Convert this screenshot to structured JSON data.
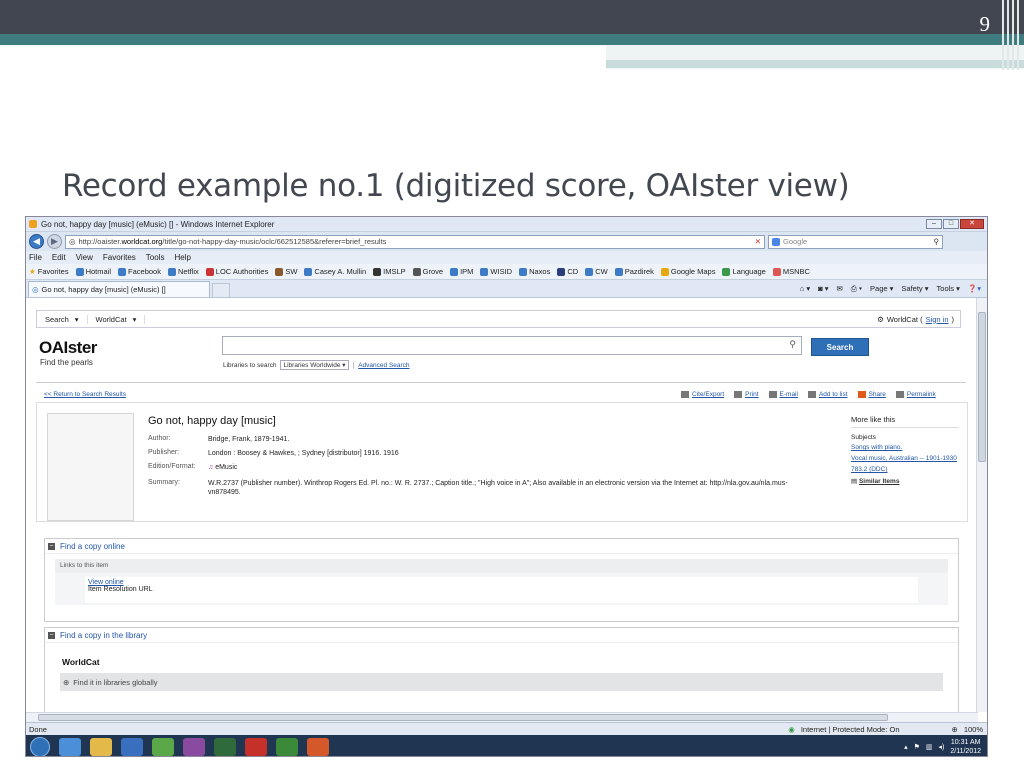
{
  "slide": {
    "number": "9",
    "title": "Record example no.1 (digitized score, OAIster view)"
  },
  "browser": {
    "window_title": "Go not, happy day [music] (eMusic) [] - Windows Internet Explorer",
    "url_prefix": "http://oaister.",
    "url_domain": "worldcat.org",
    "url_rest": "/title/go-not-happy-day-music/oclc/662512585&referer=brief_results",
    "search_placeholder": "Google",
    "menu": [
      "File",
      "Edit",
      "View",
      "Favorites",
      "Tools",
      "Help"
    ],
    "favorites_label": "Favorites",
    "favorites": [
      "Hotmail",
      "Facebook",
      "Netflix",
      "LOC Authorities",
      "SW",
      "Casey A. Mullin",
      "IMSLP",
      "Grove",
      "IPM",
      "WISID",
      "Naxos",
      "CD",
      "CW",
      "Pazdirek",
      "Google Maps",
      "Language",
      "MSNBC"
    ],
    "tab_title": "Go not, happy day [music] (eMusic) []",
    "commands": [
      "Page ▾",
      "Safety ▾",
      "Tools ▾"
    ],
    "status_left": "Done",
    "status_zone": "Internet | Protected Mode: On",
    "zoom": "100%",
    "clock_time": "10:31 AM",
    "clock_date": "2/11/2012"
  },
  "worldcat": {
    "nav_search": "Search",
    "nav_worldcat": "WorldCat",
    "signin_prefix": "WorldCat (",
    "signin_link": "Sign in",
    "signin_suffix": ")",
    "logo": "OAIster",
    "tagline": "Find the pearls",
    "search_button": "Search",
    "libraries_label": "Libraries to search",
    "libraries_value": "Libraries Worldwide",
    "advanced_search": "Advanced Search",
    "back_link": "<< Return to Search Results",
    "tools": [
      "Cite/Export",
      "Print",
      "E-mail",
      "Add to list",
      "Share",
      "Permalink"
    ],
    "record": {
      "title": "Go not, happy day [music]",
      "author_label": "Author:",
      "author": "Bridge, Frank, 1879-1941.",
      "publisher_label": "Publisher:",
      "publisher": "London : Boosey & Hawkes, ; Sydney [distributor] 1916. 1916",
      "format_label": "Edition/Format:",
      "format": "eMusic",
      "summary_label": "Summary:",
      "summary": "W.R.2737 (Publisher number). Winthrop Rogers Ed. Pl. no.: W. R. 2737.; Caption title.; \"High voice in A\"; Also available in an electronic version via the Internet at: http://nla.gov.au/nla.mus-vn878495."
    },
    "more_like_this": {
      "heading": "More like this",
      "subjects_label": "Subjects",
      "subjects": [
        "Songs with piano.",
        "Vocal music, Australian -- 1901-1930",
        "783.2 (DDC)"
      ],
      "similar_items": "Similar Items"
    },
    "find_online": {
      "heading": "Find a copy online",
      "links_heading": "Links to this item",
      "view_online": "View online",
      "resolution": "Item Resolution URL"
    },
    "find_library": {
      "heading": "Find a copy in the library",
      "worldcat_label": "WorldCat",
      "find_globally": "Find it in libraries globally"
    }
  },
  "colors": {
    "slide_bar": "#414651",
    "slide_teal": "#3f7c7f",
    "link_blue": "#2356a8",
    "search_button": "#2f6fb7"
  }
}
